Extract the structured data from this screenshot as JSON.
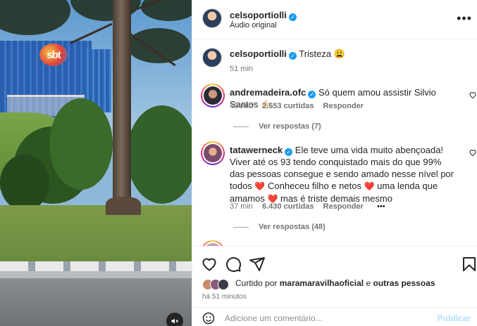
{
  "post": {
    "author": "celsoportiolli",
    "audio": "Áudio original",
    "media_logo": "sbt"
  },
  "caption": {
    "author": "celsoportiolli",
    "text": "Tristeza 😩",
    "time": "51 min"
  },
  "comments": [
    {
      "author": "andremadeira.ofc",
      "text": "Só quem amou assistir Silvio Santos 👉🏻",
      "time": "49 min",
      "likes": "2.653 curtidas",
      "reply": "Responder",
      "view_replies": "Ver respostas (7)"
    },
    {
      "author": "tatawerneck",
      "text_parts": [
        "Ele teve uma vida muito abençoada! Viver até os 93 tendo conquistado mais do que 99% das pessoas consegue e sendo amado nesse nível por todos ",
        "❤️",
        " Conheceu filho e netos ",
        "❤️",
        " uma lenda que amamos ",
        "❤️",
        " mas é triste demais mesmo"
      ],
      "time": "37 min",
      "likes": "6.430 curtidas",
      "reply": "Responder",
      "more": "•••",
      "view_replies": "Ver respostas (48)"
    }
  ],
  "footer": {
    "liked_prefix": "Curtido por",
    "liked_user": "maramaravilhaoficial",
    "liked_and": "e",
    "liked_others": "outras pessoas",
    "time_ago": "há 51 minutos",
    "comment_placeholder": "Adicione um comentário...",
    "publish": "Publicar"
  },
  "icons": {
    "more": "more-icon",
    "heart": "heart-icon",
    "comment": "comment-icon",
    "share": "share-icon",
    "bookmark": "bookmark-icon",
    "emoji": "emoji-icon",
    "mute": "speaker-muted-icon"
  },
  "colors": {
    "verified": "#1d9bf0",
    "meta_gray": "#737373",
    "publish_disabled": "#b2dffc",
    "heart_red": "#e0245e"
  }
}
